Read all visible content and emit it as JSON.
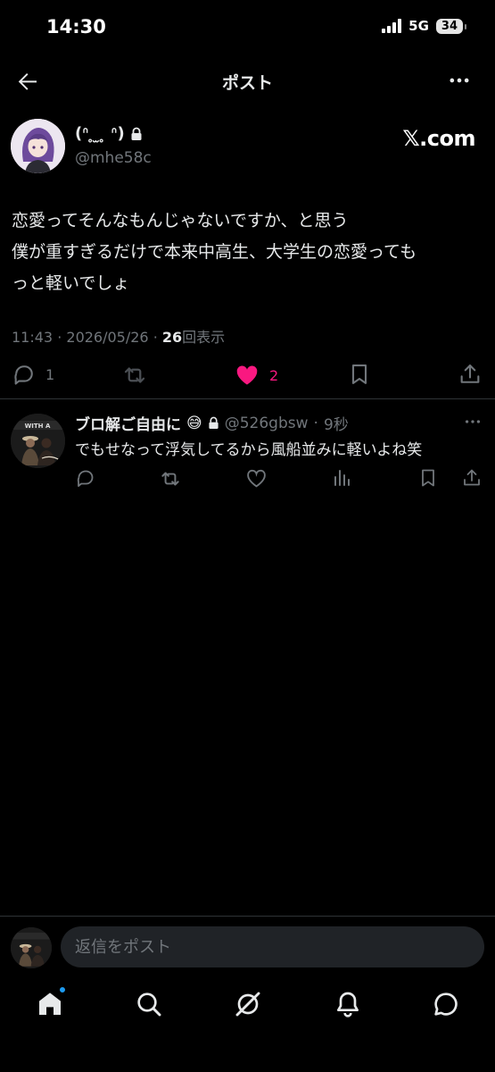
{
  "status_bar": {
    "time": "14:30",
    "network": "5G",
    "battery": "34"
  },
  "topbar": {
    "title": "ポスト",
    "back_icon": "arrow-left-icon",
    "more_icon": "ellipsis-icon"
  },
  "author": {
    "display_name": "(ᐢ ̥ ̫ ̥ ᐢ)",
    "handle": "@mhe58c",
    "source_mark": "𝕏.com",
    "locked": true
  },
  "post": {
    "text": "恋愛ってそんなもんじゃないですか、と思う\n僕が重すぎるだけで本来中高生、大学生の恋愛っても\nっと軽いでしょ",
    "time": "11:43",
    "date": "2026/05/26",
    "views_count": "26",
    "views_label": "回表示",
    "separator": "·",
    "replies": "1",
    "likes": "2",
    "like_color": "#f91880"
  },
  "reply": {
    "name": "ブロ解ご自由に",
    "emoji": "😅",
    "handle": "@526gbsw",
    "separator": "·",
    "time": "9秒",
    "text": "でもせなって浮気してるから風船並みに軽いよね笑"
  },
  "compose": {
    "placeholder": "返信をポスト"
  },
  "tabs": [
    "home-icon",
    "search-icon",
    "grok-icon",
    "notifications-icon",
    "messages-icon"
  ],
  "colors": {
    "background": "#000000",
    "text": "#e7e9ea",
    "muted": "#71767b",
    "accent": "#1d9bf0"
  }
}
